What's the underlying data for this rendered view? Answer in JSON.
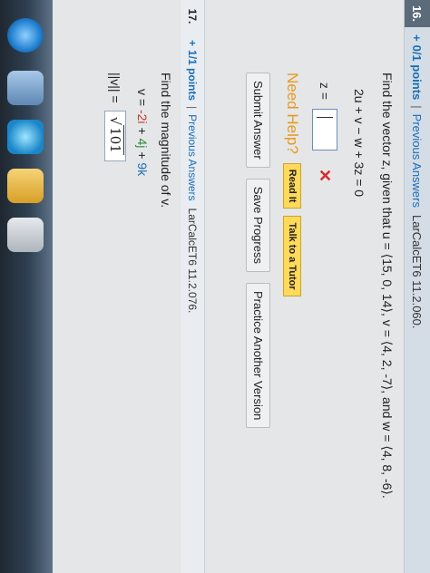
{
  "taskbar": {
    "icons": [
      "windows-start-icon",
      "explorer-icon",
      "internet-explorer-icon",
      "folder-icon",
      "document-icon"
    ]
  },
  "q16": {
    "number": "16.",
    "points": "0/1 points",
    "separator": "|",
    "previous_answers": "Previous Answers",
    "source": "LarCalcET6 11.2.060.",
    "problem_text": "Find the vector z, given that u = ⟨15, 0, 14⟩, v = ⟨4, 2, -7⟩, and w = ⟨4, 8, -6⟩.",
    "equation": "2u + v − w + 3z = 0",
    "answer_label": "z =",
    "answer_value": "",
    "incorrect_mark": "✕",
    "need_help": "Need Help?",
    "read_it": "Read It",
    "talk_to_tutor": "Talk to a Tutor",
    "submit_answer": "Submit Answer",
    "save_progress": "Save Progress",
    "practice_another": "Practice Another Version"
  },
  "q17": {
    "number": "17.",
    "points": "1/1 points",
    "separator": "|",
    "previous_answers": "Previous Answers",
    "source": "LarCalcET6 11.2.076.",
    "problem_text": "Find the magnitude of v.",
    "v_prefix": "v = ",
    "v_i_coef": "-2i",
    "v_plus1": " + ",
    "v_j_coef": "4j",
    "v_plus2": " + ",
    "v_k_coef": "9k",
    "norm_label": "||v|| =",
    "sqrt_symbol": "√",
    "sqrt_value": "101"
  },
  "colors": {
    "link": "#1b6fb6",
    "need_help": "#e79a1b",
    "incorrect": "#d12e2e",
    "tutor_button": "#ffd95a"
  }
}
